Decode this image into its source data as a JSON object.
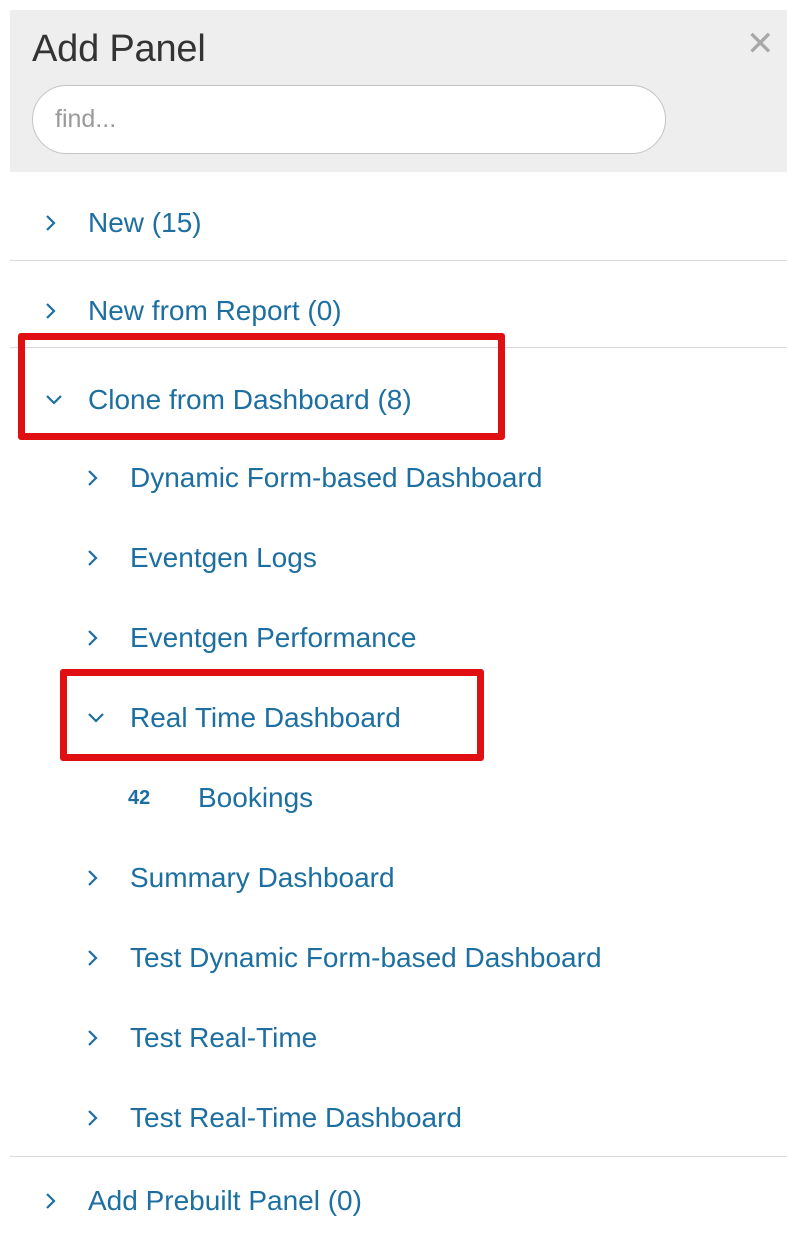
{
  "panel": {
    "title": "Add Panel",
    "close_icon": "close-icon",
    "search": {
      "placeholder": "find...",
      "value": ""
    }
  },
  "sections": {
    "new": "New (15)",
    "new_from_report": "New from Report (0)",
    "clone_from_dashboard": "Clone from Dashboard (8)",
    "add_prebuilt_panel": "Add Prebuilt Panel (0)"
  },
  "dashboards": [
    {
      "label": "Dynamic Form-based Dashboard",
      "expanded": false
    },
    {
      "label": "Eventgen Logs",
      "expanded": false
    },
    {
      "label": "Eventgen Performance",
      "expanded": false
    },
    {
      "label": "Real Time Dashboard",
      "expanded": true,
      "panels": [
        {
          "badge": "42",
          "label": "Bookings"
        }
      ]
    },
    {
      "label": "Summary Dashboard",
      "expanded": false
    },
    {
      "label": "Test Dynamic Form-based Dashboard",
      "expanded": false
    },
    {
      "label": "Test Real-Time",
      "expanded": false
    },
    {
      "label": "Test Real-Time Dashboard",
      "expanded": false
    }
  ],
  "colors": {
    "link": "#1d6fa1",
    "header_bg": "#eeeeee",
    "highlight": "#e00f12"
  }
}
